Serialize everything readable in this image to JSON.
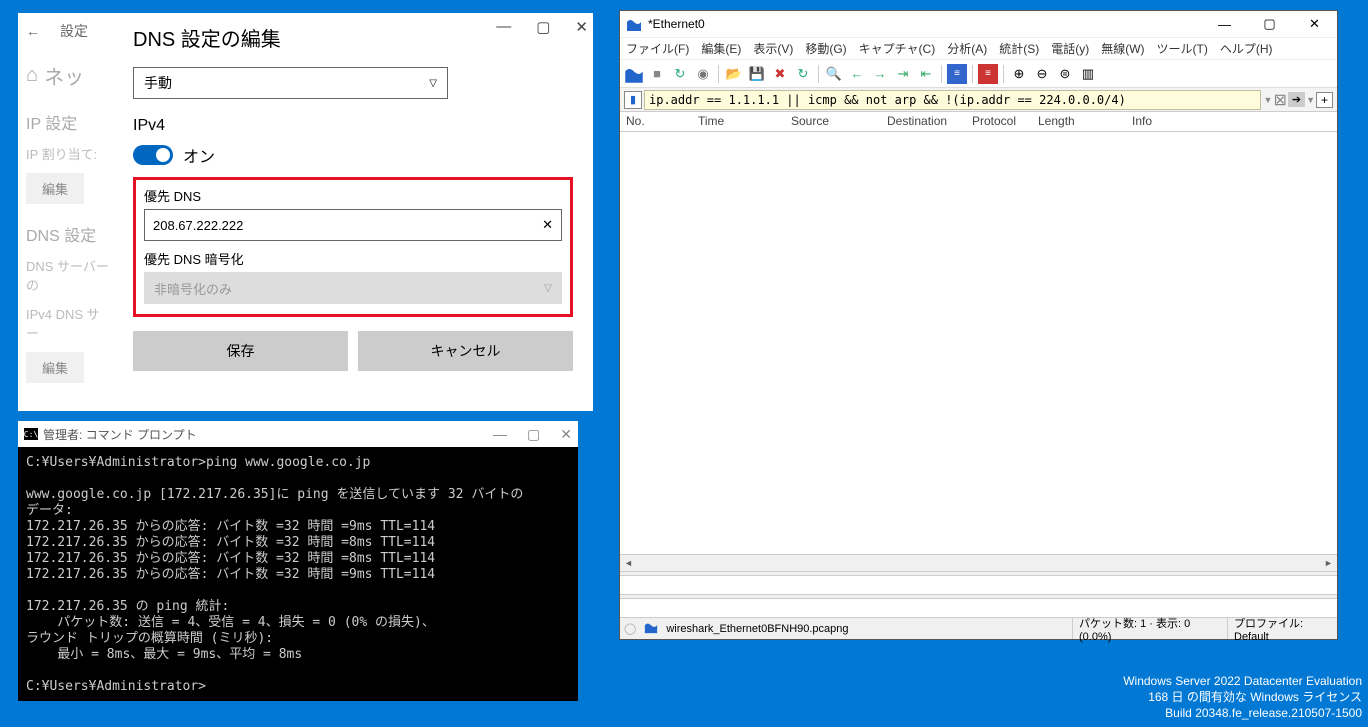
{
  "settings": {
    "back_label": "設定",
    "home_label": "ネッ",
    "ip_settings_header": "IP 設定",
    "ip_assign_label": "IP 割り当て:",
    "edit_btn": "編集",
    "dns_settings_header": "DNS 設定",
    "dns_server_label": "DNS サーバーの",
    "ipv4_dns_label": "IPv4 DNS サー",
    "panel_title": "DNS 設定の編集",
    "manual_option": "手動",
    "ipv4_heading": "IPv4",
    "toggle_label": "オン",
    "preferred_dns_label": "優先 DNS",
    "preferred_dns_value": "208.67.222.222",
    "encryption_label": "優先 DNS 暗号化",
    "encryption_value": "非暗号化のみ",
    "save_btn": "保存",
    "cancel_btn": "キャンセル"
  },
  "cmd": {
    "title": "管理者: コマンド プロンプト",
    "body": "C:¥Users¥Administrator>ping www.google.co.jp\n\nwww.google.co.jp [172.217.26.35]に ping を送信しています 32 バイトの\nデータ:\n172.217.26.35 からの応答: バイト数 =32 時間 =9ms TTL=114\n172.217.26.35 からの応答: バイト数 =32 時間 =8ms TTL=114\n172.217.26.35 からの応答: バイト数 =32 時間 =8ms TTL=114\n172.217.26.35 からの応答: バイト数 =32 時間 =9ms TTL=114\n\n172.217.26.35 の ping 統計:\n    パケット数: 送信 = 4、受信 = 4、損失 = 0 (0% の損失)、\nラウンド トリップの概算時間 (ミリ秒):\n    最小 = 8ms、最大 = 9ms、平均 = 8ms\n\nC:¥Users¥Administrator>"
  },
  "wireshark": {
    "title": "*Ethernet0",
    "menu": [
      "ファイル(F)",
      "編集(E)",
      "表示(V)",
      "移動(G)",
      "キャプチャ(C)",
      "分析(A)",
      "統計(S)",
      "電話(y)",
      "無線(W)",
      "ツール(T)",
      "ヘルプ(H)"
    ],
    "filter": "ip.addr == 1.1.1.1 || icmp && not arp && !(ip.addr == 224.0.0.0/4)",
    "columns": [
      "No.",
      "Time",
      "Source",
      "Destination",
      "Protocol",
      "Length",
      "Info"
    ],
    "status_file": "wireshark_Ethernet0BFNH90.pcapng",
    "status_packets": "パケット数: 1 · 表示: 0 (0.0%)",
    "status_profile": "プロファイル: Default"
  },
  "watermark": {
    "line1": "Windows Server 2022 Datacenter Evaluation",
    "line2": "168 日 の間有効な Windows ライセンス",
    "line3": "Build 20348.fe_release.210507-1500"
  }
}
